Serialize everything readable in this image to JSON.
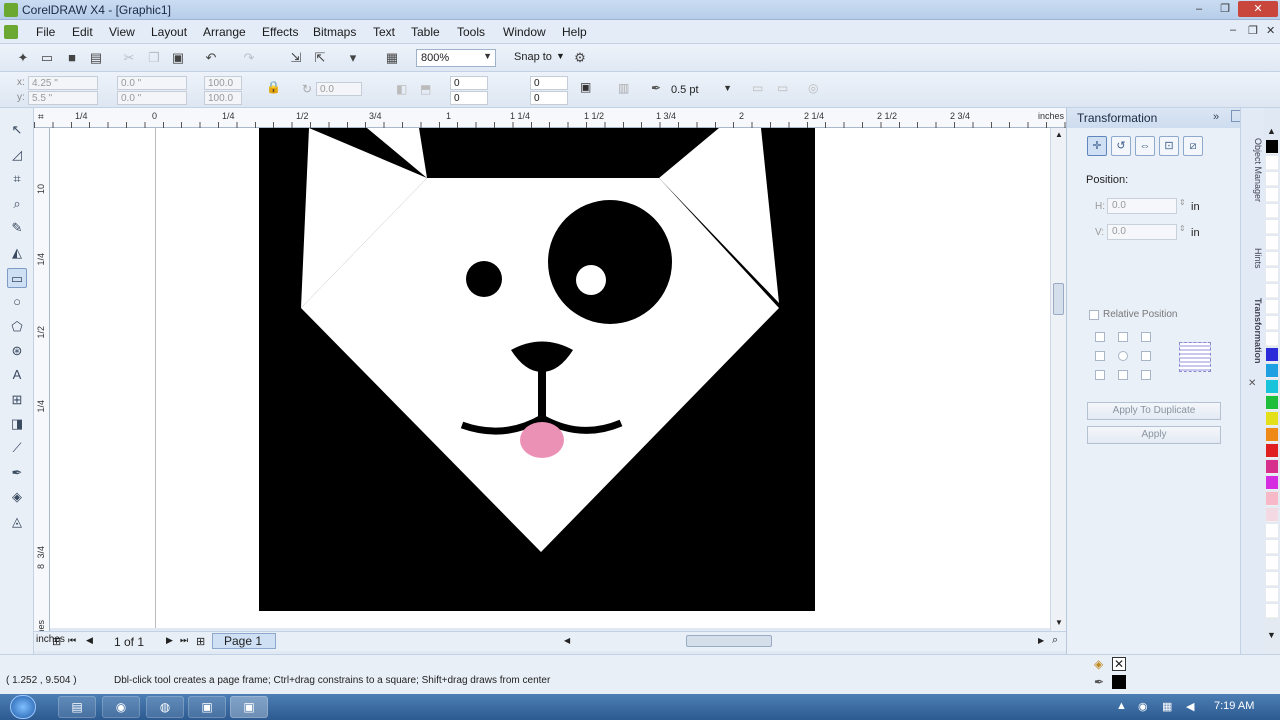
{
  "window": {
    "title": "CorelDRAW X4 - [Graphic1]",
    "controls": [
      "–",
      "❐",
      "✕"
    ]
  },
  "menu": {
    "items": [
      "File",
      "Edit",
      "View",
      "Layout",
      "Arrange",
      "Effects",
      "Bitmaps",
      "Text",
      "Table",
      "Tools",
      "Window",
      "Help"
    ],
    "mdi_controls": [
      "–",
      "❐",
      "✕"
    ]
  },
  "standard_toolbar": {
    "zoom_level": "800%",
    "snap_to": "Snap to"
  },
  "property_bar": {
    "x": "4.25 \"",
    "y": "5.5 \"",
    "w": "0.0 \"",
    "h": "0.0 \"",
    "scale_w": "100.0",
    "scale_h": "100.0",
    "rotation": "0.0",
    "corner_tl": "0",
    "corner_bl": "0",
    "corner_tr": "0",
    "corner_br": "0",
    "outline_width": "0.5 pt",
    "x_label": "x:",
    "y_label": "y:"
  },
  "rulers": {
    "units": "inches",
    "h_ticks": [
      "1/4",
      "0",
      "1/4",
      "1/2",
      "3/4",
      "1",
      "1 1/4",
      "1 1/2",
      "1 3/4",
      "2",
      "2 1/4",
      "2 1/2",
      "2 3/4"
    ],
    "v_ticks": [
      "10",
      "1/4",
      "1/2",
      "1/4",
      "3/4",
      "8"
    ]
  },
  "page_nav": {
    "page_count": "1 of 1",
    "page_tab": "Page 1"
  },
  "docker": {
    "title": "Transformation",
    "position_label": "Position:",
    "h_label": "H:",
    "v_label": "V:",
    "h_value": "0.0",
    "v_value": "0.0",
    "h_unit": "in",
    "v_unit": "in",
    "relative_position": "Relative Position",
    "apply_to_duplicate": "Apply To Duplicate",
    "apply": "Apply"
  },
  "side_tabs": [
    "Object Manager",
    "Hints",
    "Transformation"
  ],
  "palette_colors": [
    "#000000",
    "#ffffff",
    "#ffffff",
    "#ffffff",
    "#ffffff",
    "#ffffff",
    "#ffffff",
    "#ffffff",
    "#ffffff",
    "#ffffff",
    "#ffffff",
    "#ffffff",
    "#ffffff",
    "#2a2ad9",
    "#1fa0e0",
    "#17c4d9",
    "#1dbf3a",
    "#e3e01a",
    "#f08a16",
    "#e02020",
    "#d62f8c",
    "#d52ee0",
    "#f7b8c8",
    "#f3d9e1",
    "#ffffff",
    "#ffffff",
    "#ffffff",
    "#ffffff",
    "#ffffff",
    "#ffffff"
  ],
  "status": {
    "coords": "( 1.252 , 9.504 )",
    "hint": "Dbl-click tool creates a page frame; Ctrl+drag constrains to a square; Shift+drag draws from center"
  },
  "taskbar": {
    "time": "7:19 AM"
  },
  "colors": {
    "artwork_bg": "#000000",
    "face": "#ffffff",
    "tongue": "#ec91b6"
  }
}
